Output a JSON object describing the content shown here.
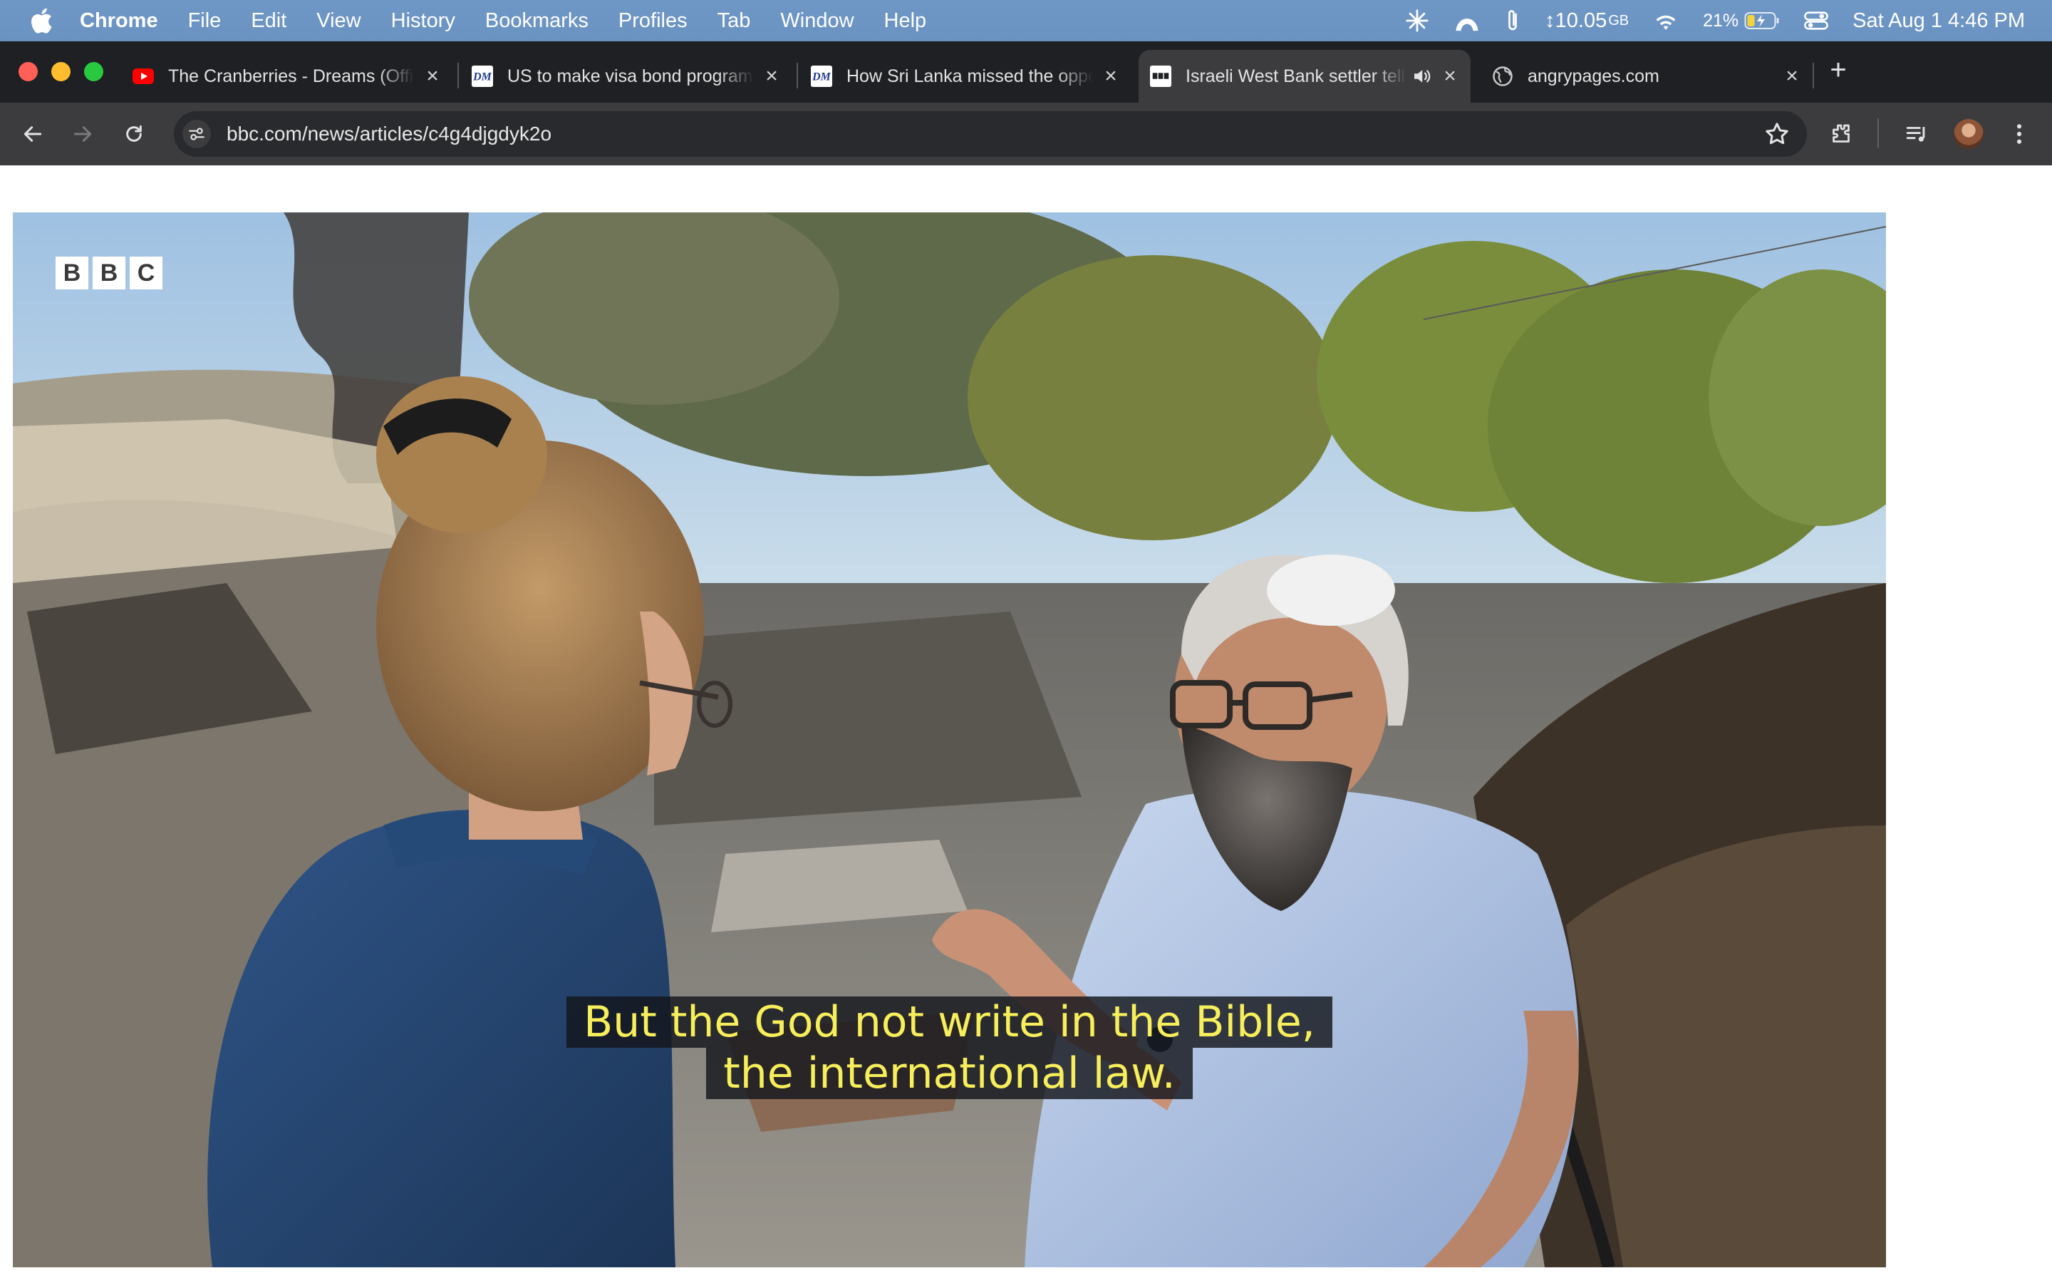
{
  "menubar": {
    "app_name": "Chrome",
    "items": [
      "File",
      "Edit",
      "View",
      "History",
      "Bookmarks",
      "Profiles",
      "Tab",
      "Window",
      "Help"
    ],
    "status": {
      "memory_value": "↕10.05",
      "memory_unit": "GB",
      "battery_percent": "21%",
      "datetime": "Sat Aug 1  4:46 PM"
    }
  },
  "tabs": [
    {
      "title": "The Cranberries - Dreams (Official Music Video)",
      "favicon": "youtube-icon",
      "active": false
    },
    {
      "title": "US to make visa bond program",
      "favicon": "dm-icon",
      "active": false
    },
    {
      "title": "How Sri Lanka missed the opportunity",
      "favicon": "dm-icon",
      "active": false
    },
    {
      "title": "Israeli West Bank settler tells BBC",
      "favicon": "bbc-icon",
      "active": true,
      "audio": true
    },
    {
      "title": "angrypages.com",
      "favicon": "globe-icon",
      "active": false
    }
  ],
  "address_bar": {
    "url": "bbc.com/news/articles/c4g4djgdyk2o"
  },
  "video": {
    "logo": "BBC",
    "logo_letters": [
      "B",
      "B",
      "C"
    ],
    "subtitle_lines": [
      "But the God not write in the Bible,",
      "the international law."
    ],
    "subtitle_color": "#f6ee5a"
  },
  "colors": {
    "menubar": "#6f97c6",
    "tabstrip": "#1f2023",
    "toolbar": "#3c3c3f",
    "omnibox": "#282a2d"
  }
}
